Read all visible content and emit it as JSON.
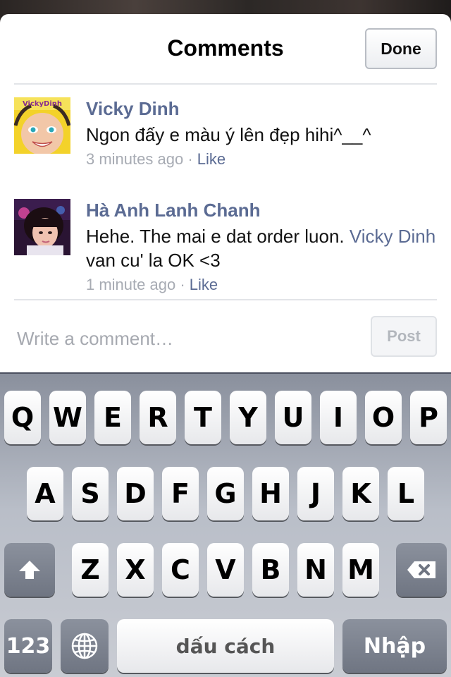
{
  "header": {
    "title": "Comments",
    "done_label": "Done"
  },
  "comments": [
    {
      "author": "Vicky Dinh",
      "text": "Ngon đấy e màu ý lên đẹp hihi^__^",
      "time": "3 minutes ago",
      "separator": "·",
      "like_label": "Like",
      "avatar_text": "VickyDinh"
    },
    {
      "author": "Hà Anh Lanh Chanh",
      "text_before": "Hehe. The mai e dat order luon.",
      "mention": "Vicky Dinh",
      "text_after": "van cu' la OK <3",
      "time": "1 minute ago",
      "separator": "·",
      "like_label": "Like"
    }
  ],
  "composer": {
    "placeholder": "Write a comment…",
    "post_label": "Post"
  },
  "keyboard": {
    "row1": [
      "Q",
      "W",
      "E",
      "R",
      "T",
      "Y",
      "U",
      "I",
      "O",
      "P"
    ],
    "row2": [
      "A",
      "S",
      "D",
      "F",
      "G",
      "H",
      "J",
      "K",
      "L"
    ],
    "row3": [
      "Z",
      "X",
      "C",
      "V",
      "B",
      "N",
      "M"
    ],
    "numbers_label": "123",
    "space_label": "dấu cách",
    "return_label": "Nhập",
    "icons": {
      "shift": "shift-icon",
      "delete": "delete-icon",
      "globe": "globe-icon"
    }
  },
  "colors": {
    "link": "#5b6b93",
    "meta": "#a7abb3",
    "keyboard_bg": "#b9bec8"
  }
}
